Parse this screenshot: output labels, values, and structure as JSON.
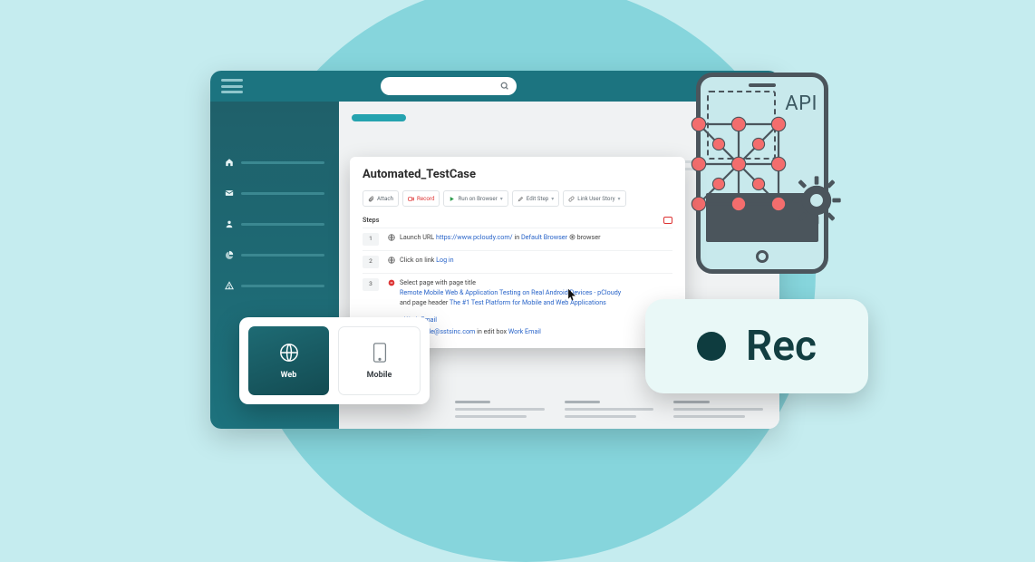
{
  "colors": {
    "accent": "#25a3af",
    "link": "#2a65c9",
    "danger": "#d33"
  },
  "sidebar": {
    "items": [
      {
        "icon": "home-icon"
      },
      {
        "icon": "mail-icon"
      },
      {
        "icon": "user-icon"
      },
      {
        "icon": "piechart-icon"
      },
      {
        "icon": "alert-icon"
      }
    ]
  },
  "card": {
    "title": "Automated_TestCase",
    "toolbar": {
      "attach": "Attach",
      "record": "Record",
      "run": "Run on Browser",
      "edit": "Edit Step",
      "link": "Link User Story"
    },
    "steps_label": "Steps",
    "steps": [
      {
        "n": "1",
        "pre": "Launch URL",
        "url": "https://www.pcloudy.com/",
        "mid": "in",
        "browser": "Default Browser",
        "suffix": "browser"
      },
      {
        "n": "2",
        "pre": "Click on link",
        "link": "Log in"
      },
      {
        "n": "3",
        "pre": "Select page with page title",
        "title_link": "Remote Mobile Web & Application Testing on Real Android Devices - pCloudy",
        "mid": "and page header",
        "header_link": "The #1 Test Platform for Mobile and Web Applications"
      }
    ],
    "fragment1": "Work Email",
    "fragment2_email": "ash.ingole@sstsinc.com",
    "fragment2_mid": "in edit box",
    "fragment2_field": "Work Email"
  },
  "chooser": {
    "web": "Web",
    "mobile": "Mobile"
  },
  "phone": {
    "api": "API"
  },
  "rec": {
    "label": "Rec"
  }
}
